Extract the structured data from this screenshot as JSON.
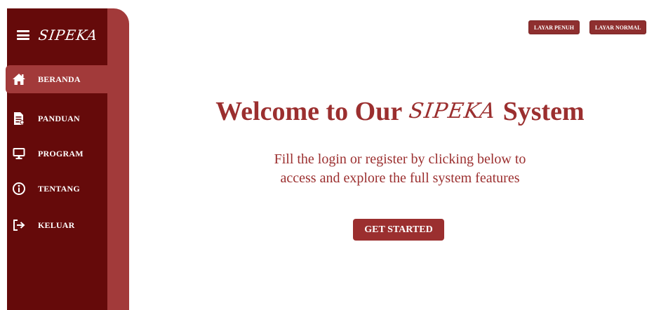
{
  "sidebar": {
    "brand": "SIPEKA",
    "items": [
      {
        "label": "BERANDA",
        "icon": "home-icon",
        "active": true
      },
      {
        "label": "PANDUAN",
        "icon": "document-icon"
      },
      {
        "label": "PROGRAM",
        "icon": "monitor-icon"
      },
      {
        "label": "TENTANG",
        "icon": "info-icon"
      },
      {
        "label": "KELUAR",
        "icon": "logout-icon"
      }
    ]
  },
  "header": {
    "fullscreen_label": "LAYAR PENUH",
    "normal_label": "LAYAR NORMAL"
  },
  "hero": {
    "title_prefix": "Welcome to Our",
    "title_brand": "SIPEKA",
    "title_suffix": "System",
    "subtitle_line1": "Fill the login or register by clicking below to",
    "subtitle_line2": "access and explore the full system features",
    "cta_label": "GET STARTED"
  },
  "colors": {
    "sidebar_dark": "#650a0a",
    "sidebar_accent": "#a23a3a",
    "primary": "#9b2f2f"
  }
}
